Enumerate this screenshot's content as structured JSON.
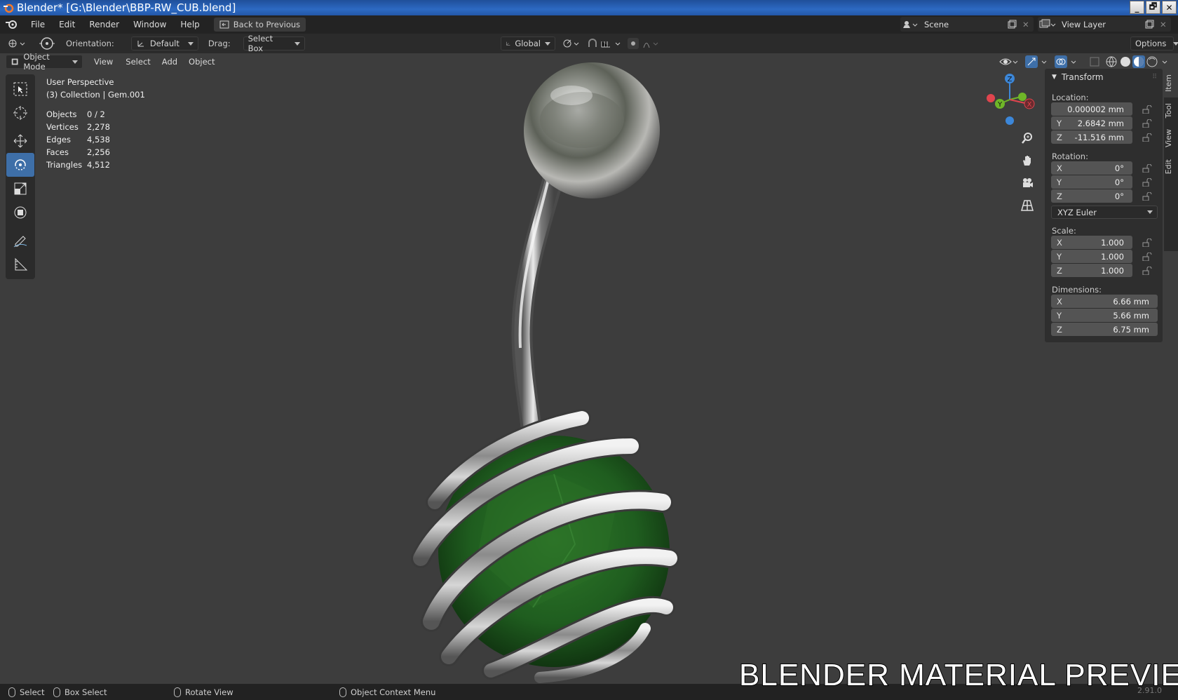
{
  "window": {
    "title": "Blender* [G:\\Blender\\BBP-RW_CUB.blend]",
    "minimize": "_",
    "maximize": "🗗",
    "close": "✕"
  },
  "menubar": {
    "items": [
      "File",
      "Edit",
      "Render",
      "Window",
      "Help"
    ],
    "back_button": "Back to Previous",
    "scene": "Scene",
    "view_layer": "View Layer"
  },
  "header": {
    "orientation_label": "Orientation:",
    "orientation_value": "Default",
    "drag_label": "Drag:",
    "drag_value": "Select Box",
    "transform_orientation": "Global",
    "options": "Options"
  },
  "viewport_header": {
    "mode": "Object Mode",
    "menus": [
      "View",
      "Select",
      "Add",
      "Object"
    ]
  },
  "overlay": {
    "view_name": "User Perspective",
    "collection": "(3) Collection | Gem.001",
    "stats": [
      {
        "label": "Objects",
        "value": "0 / 2"
      },
      {
        "label": "Vertices",
        "value": "2,278"
      },
      {
        "label": "Edges",
        "value": "4,538"
      },
      {
        "label": "Faces",
        "value": "2,256"
      },
      {
        "label": "Triangles",
        "value": "4,512"
      }
    ]
  },
  "gizmo": {
    "z": "Z",
    "y": "Y",
    "x": "X",
    "colors": {
      "x": "#e0454e",
      "y": "#6fb628",
      "z": "#3c87d9"
    }
  },
  "npanel": {
    "section": "Transform",
    "location_label": "Location:",
    "location": [
      {
        "axis": "",
        "value": "0.000002 mm"
      },
      {
        "axis": "Y",
        "value": "2.6842 mm"
      },
      {
        "axis": "Z",
        "value": "-11.516 mm"
      }
    ],
    "rotation_label": "Rotation:",
    "rotation": [
      {
        "axis": "X",
        "value": "0°"
      },
      {
        "axis": "Y",
        "value": "0°"
      },
      {
        "axis": "Z",
        "value": "0°"
      }
    ],
    "rotation_mode": "XYZ Euler",
    "scale_label": "Scale:",
    "scale": [
      {
        "axis": "X",
        "value": "1.000"
      },
      {
        "axis": "Y",
        "value": "1.000"
      },
      {
        "axis": "Z",
        "value": "1.000"
      }
    ],
    "dimensions_label": "Dimensions:",
    "dimensions": [
      {
        "axis": "X",
        "value": "6.66 mm"
      },
      {
        "axis": "Y",
        "value": "5.66 mm"
      },
      {
        "axis": "Z",
        "value": "6.75 mm"
      }
    ],
    "tabs": [
      "Item",
      "Tool",
      "View",
      "Edit"
    ]
  },
  "statusbar": {
    "select": "Select",
    "box_select": "Box Select",
    "rotate_view": "Rotate View",
    "context_menu": "Object Context Menu",
    "version": "2.91.0"
  },
  "watermark": "BLENDER MATERIAL PREVIEW",
  "colors": {
    "accent": "#3e6fa8",
    "gem": "#1f5d1f"
  }
}
